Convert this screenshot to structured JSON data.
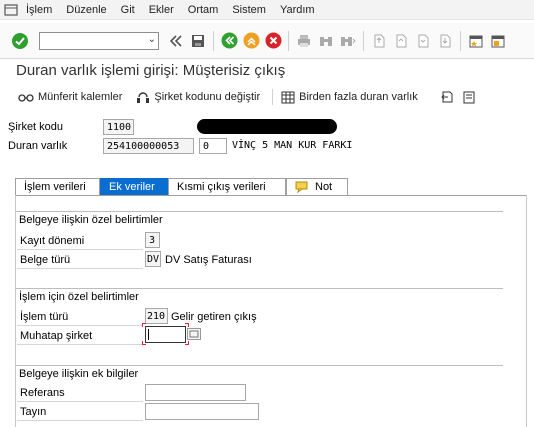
{
  "menubar": {
    "items": [
      "İşlem",
      "Düzenle",
      "Git",
      "Ekler",
      "Ortam",
      "Sistem",
      "Yardım"
    ]
  },
  "toolbar": {
    "command_value": "",
    "icons": [
      "check-icon",
      "back-icon",
      "save-icon",
      "nav-back-icon",
      "exit-icon",
      "cancel-icon",
      "print-icon",
      "find-icon",
      "find-next-icon",
      "first-page-icon",
      "prev-page-icon",
      "next-page-icon",
      "last-page-icon",
      "create-session-icon",
      "shortcut-icon"
    ]
  },
  "page": {
    "title": "Duran varlık işlemi girişi: Müşterisiz çıkış"
  },
  "app_toolbar": {
    "buttons": [
      {
        "label": "Münferit kalemler",
        "icon": "glasses-icon"
      },
      {
        "label": "Şirket kodunu değiştir",
        "icon": "change-icon"
      },
      {
        "label": "Birden fazla duran varlık",
        "icon": "table-icon"
      }
    ]
  },
  "header": {
    "company_code_label": "Şirket kodu",
    "company_code_value": "1100",
    "asset_label": "Duran varlık",
    "asset_value": "254100000053",
    "subnumber_value": "0",
    "asset_description": "VİNÇ 5 MAN KUR FARKI"
  },
  "tabs": [
    {
      "label": "İşlem verileri",
      "active": false
    },
    {
      "label": "Ek veriler",
      "active": true
    },
    {
      "label": "Kısmi çıkış verileri",
      "active": false
    },
    {
      "label": "Not",
      "active": false
    }
  ],
  "group_doc": {
    "title": "Belgeye ilişkin özel belirtimler",
    "period_label": "Kayıt dönemi",
    "period_value": "3",
    "doctype_label": "Belge türü",
    "doctype_value": "DV",
    "doctype_text": "DV Satış Faturası"
  },
  "group_trans": {
    "title": "İşlem için özel belirtimler",
    "ttype_label": "İşlem türü",
    "ttype_value": "210",
    "ttype_text": "Gelir getiren çıkış",
    "partner_label": "Muhatap şirket",
    "partner_value": ""
  },
  "group_add": {
    "title": "Belgeye ilişkin ek bilgiler",
    "reference_label": "Referans",
    "reference_value": "",
    "assignment_label": "Tayın",
    "assignment_value": ""
  },
  "colors": {
    "accent": "#0a6ed1",
    "ok_green": "#2ea02e",
    "nav_green": "#30a030",
    "exit_orange": "#f0a020",
    "cancel_red": "#d8232a",
    "focus_marker": "#e0223a"
  }
}
